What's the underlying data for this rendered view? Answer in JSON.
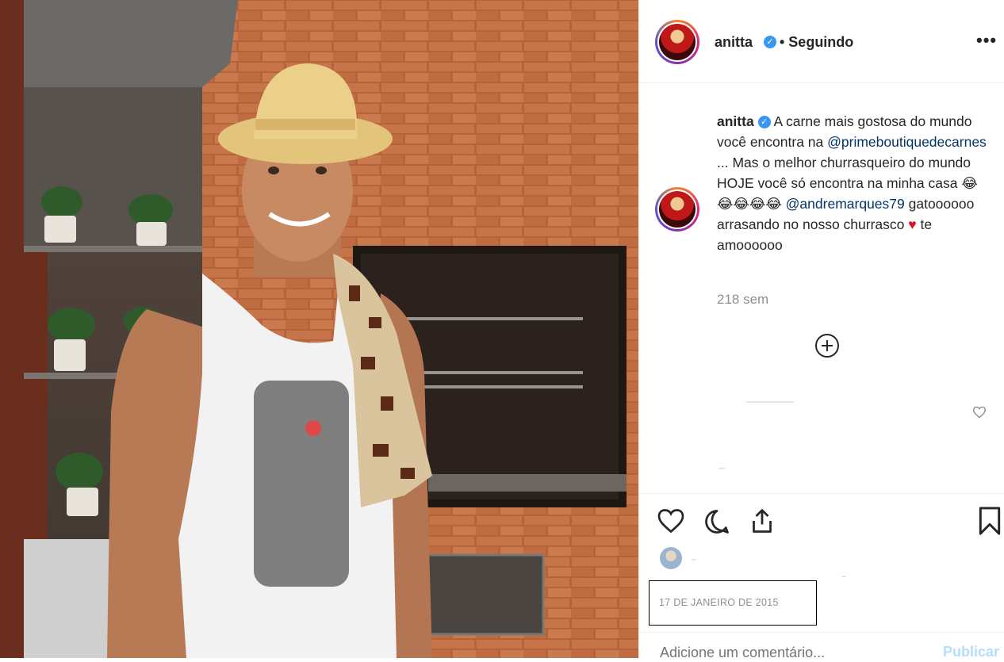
{
  "post": {
    "photo_description": "man in straw hat at brick barbecue"
  },
  "header": {
    "username": "anitta",
    "follow_status": "• Seguindo",
    "more_icon": "more-horizontal-icon",
    "verified_glyph": "✓"
  },
  "caption": {
    "username": "anitta",
    "text_1": "A carne mais gostosa do mundo você encontra na",
    "mention_1": "@primeboutiquedecarnes",
    "text_2": "... Mas o melhor churrasqueiro do mundo HOJE você só encontra na minha casa",
    "emoji": "😂😂😂😂😂",
    "mention_2": "@andremarques79",
    "text_3": "gatoooooo arrasando no nosso churrasco",
    "heart": "♥",
    "text_4": "te amoooooo",
    "time": "218 sem"
  },
  "actions": {
    "like_icon": "heart-icon",
    "comment_icon": "comment-icon",
    "share_icon": "share-icon",
    "save_icon": "bookmark-icon"
  },
  "date": "17 DE JANEIRO DE 2015",
  "comment_box": {
    "placeholder": "Adicione um comentário...",
    "publish_label": "Publicar"
  },
  "colors": {
    "verified": "#3897f0",
    "mention": "#003569",
    "publish": "#b2dffc",
    "heart": "#e0101f"
  }
}
